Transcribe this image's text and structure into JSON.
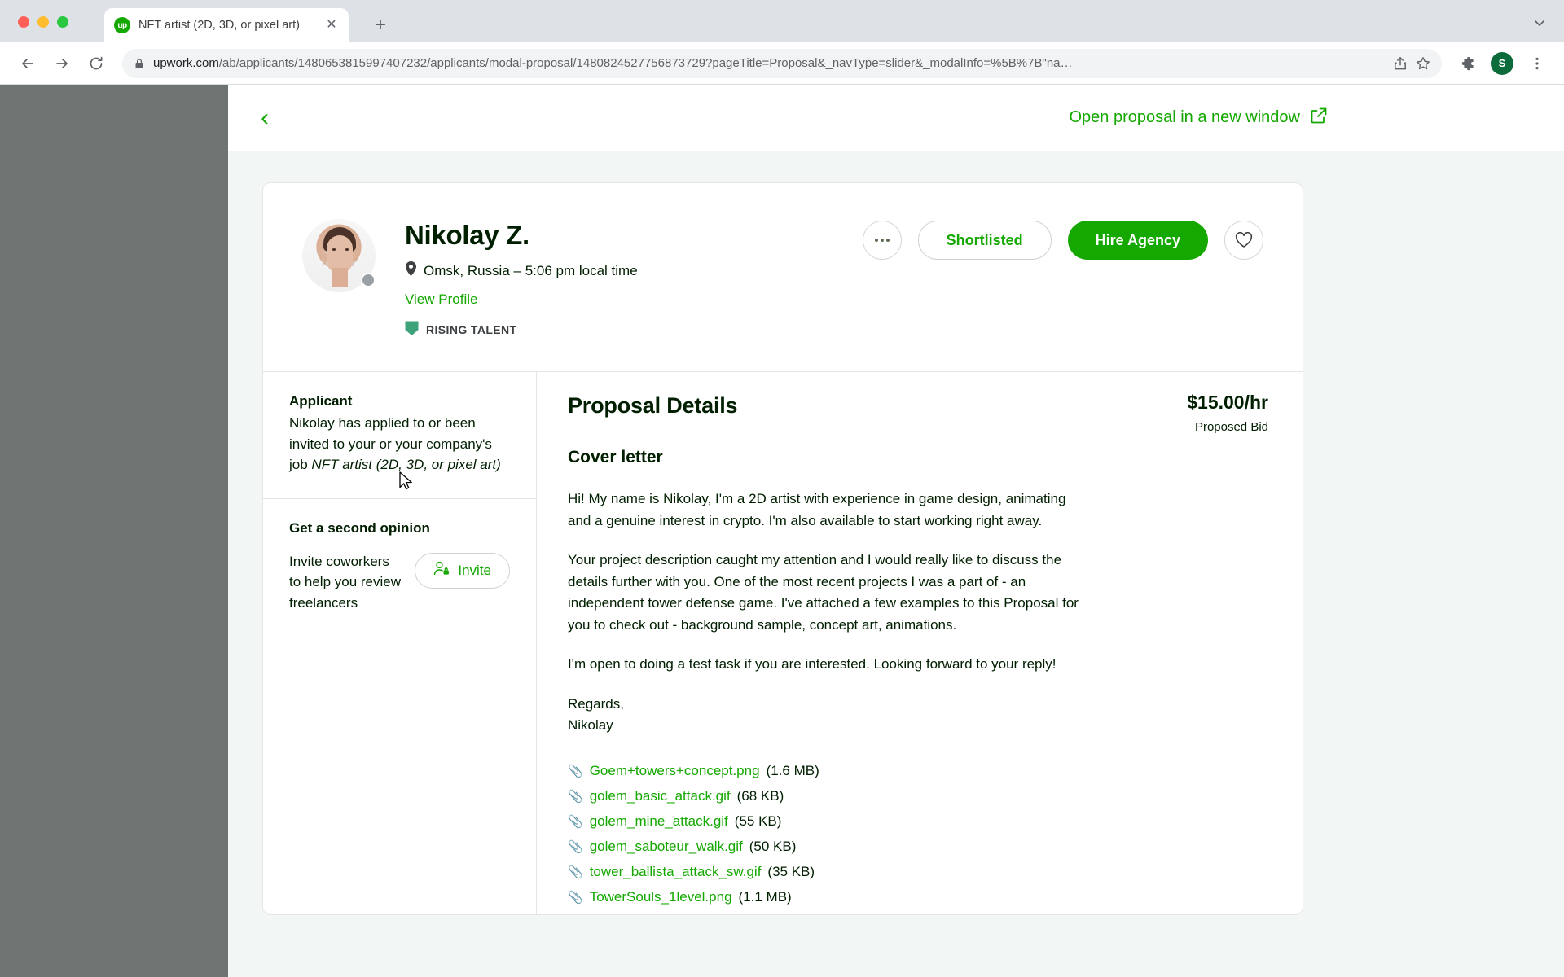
{
  "browser": {
    "tab": {
      "title": "NFT artist (2D, 3D, or pixel art)",
      "favicon_label": "up",
      "close_label": "✕"
    },
    "new_tab_label": "+",
    "url_host": "upwork.com",
    "url_path": "/ab/applicants/1480653815997407232/applicants/modal-proposal/1480824527756873729?pageTitle=Proposal&_navType=slider&_modalInfo=%5B%7B\"na…",
    "profile_initial": "S"
  },
  "slider": {
    "back_label": "‹",
    "open_new_window": "Open proposal in a new window"
  },
  "profile": {
    "name": "Nikolay Z.",
    "location": "Omsk, Russia – 5:06 pm local time",
    "view_profile": "View Profile",
    "badge": "RISING TALENT",
    "more_label": "•••",
    "shortlisted_label": "Shortlisted",
    "hire_label": "Hire Agency"
  },
  "applicant": {
    "heading": "Applicant",
    "text_part1": "Nikolay has applied to or been invited to your or your company's job ",
    "job_title": "NFT artist (2D, 3D, or pixel art)"
  },
  "second_opinion": {
    "heading": "Get a second opinion",
    "text": "Invite coworkers to help you review freelancers",
    "invite_label": "Invite"
  },
  "proposal": {
    "title": "Proposal Details",
    "bid_amount": "$15.00/hr",
    "bid_label": "Proposed Bid",
    "cover_letter_heading": "Cover letter",
    "paragraphs": [
      "Hi! My name is Nikolay, I'm a 2D artist with experience in game design, animating and a genuine interest in crypto. I'm also available to start working right away.",
      "Your project description caught my attention and I would really like to discuss the details further with you. One of the most recent projects I was a part of - an independent tower defense game. I've attached a few examples to this Proposal for you to check out - background sample, concept art, animations.",
      "I'm open to doing a test task if you are interested. Looking forward to your reply!",
      "Regards,",
      "Nikolay"
    ],
    "attachments": [
      {
        "name": "Goem+towers+concept.png",
        "size": "(1.6 MB)"
      },
      {
        "name": "golem_basic_attack.gif",
        "size": "(68 KB)"
      },
      {
        "name": "golem_mine_attack.gif",
        "size": "(55 KB)"
      },
      {
        "name": "golem_saboteur_walk.gif",
        "size": "(50 KB)"
      },
      {
        "name": "tower_ballista_attack_sw.gif",
        "size": "(35 KB)"
      },
      {
        "name": "TowerSouls_1level.png",
        "size": "(1.1 MB)"
      }
    ]
  },
  "colors": {
    "brand_green": "#14a800",
    "badge_teal": "#3fa37a",
    "text": "#001e00"
  }
}
